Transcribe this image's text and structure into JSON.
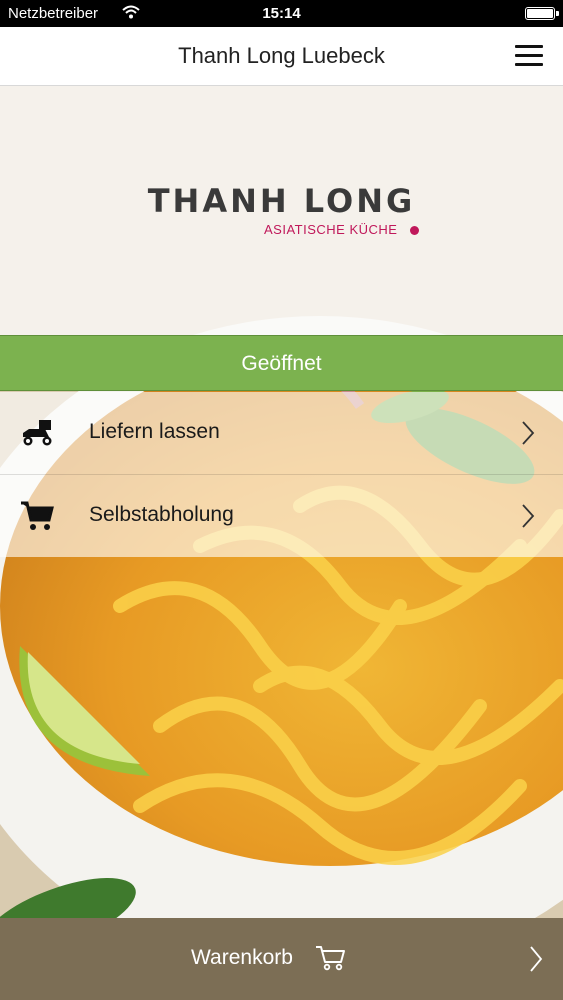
{
  "status_bar": {
    "carrier": "Netzbetreiber",
    "time": "15:14"
  },
  "navbar": {
    "title": "Thanh Long Luebeck",
    "menu_icon": "hamburger-menu-icon"
  },
  "logo": {
    "name": "THANH LONG",
    "tagline": "ASIATISCHE KÜCHE"
  },
  "status": {
    "label": "Geöffnet",
    "color": "#7cb24f"
  },
  "options": [
    {
      "label": "Liefern lassen",
      "icon": "delivery-scooter-icon"
    },
    {
      "label": "Selbstabholung",
      "icon": "shopping-cart-icon"
    }
  ],
  "cart": {
    "label": "Warenkorb",
    "icon": "cart-icon",
    "color": "#7c6e55"
  },
  "colors": {
    "accent_pink": "#c0185a",
    "open_green": "#7cb24f"
  }
}
